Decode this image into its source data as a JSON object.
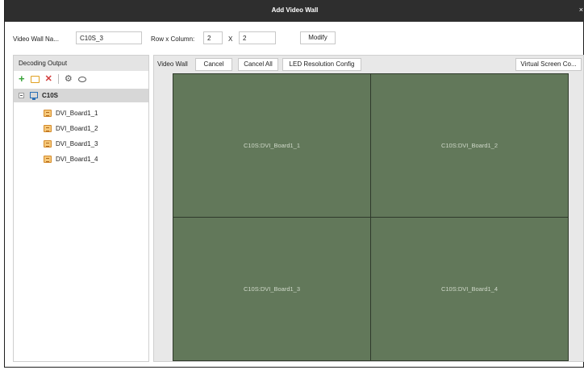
{
  "window": {
    "title": "Add Video Wall",
    "close_glyph": "×"
  },
  "form": {
    "name_label": "Video Wall Na...",
    "name_value": "C10S_3",
    "rowcol_label": "Row x Column:",
    "rows_value": "2",
    "times": "X",
    "cols_value": "2",
    "modify_label": "Modify"
  },
  "left_panel": {
    "header": "Decoding Output",
    "toolbar": [
      "add-icon",
      "folder-icon",
      "delete-icon",
      "settings-icon",
      "view-icon"
    ],
    "root": {
      "label": "C10S",
      "icon": "monitor-icon"
    },
    "children": [
      "DVI_Board1_1",
      "DVI_Board1_2",
      "DVI_Board1_3",
      "DVI_Board1_4"
    ]
  },
  "right_panel": {
    "title": "Video Wall",
    "cancel_label": "Cancel",
    "cancel_all_label": "Cancel All",
    "led_label": "LED Resolution Config",
    "virtual_label": "Virtual Screen Co..."
  },
  "screens": [
    "C10S:DVI_Board1_1",
    "C10S:DVI_Board1_2",
    "C10S:DVI_Board1_3",
    "C10S:DVI_Board1_4"
  ],
  "colors": {
    "titlebar": "#2e2e2e",
    "screen_fill": "#62785a",
    "tree_selected": "#d7d7d7",
    "add_green": "#3aa33a",
    "delete_red": "#d23b3b"
  }
}
